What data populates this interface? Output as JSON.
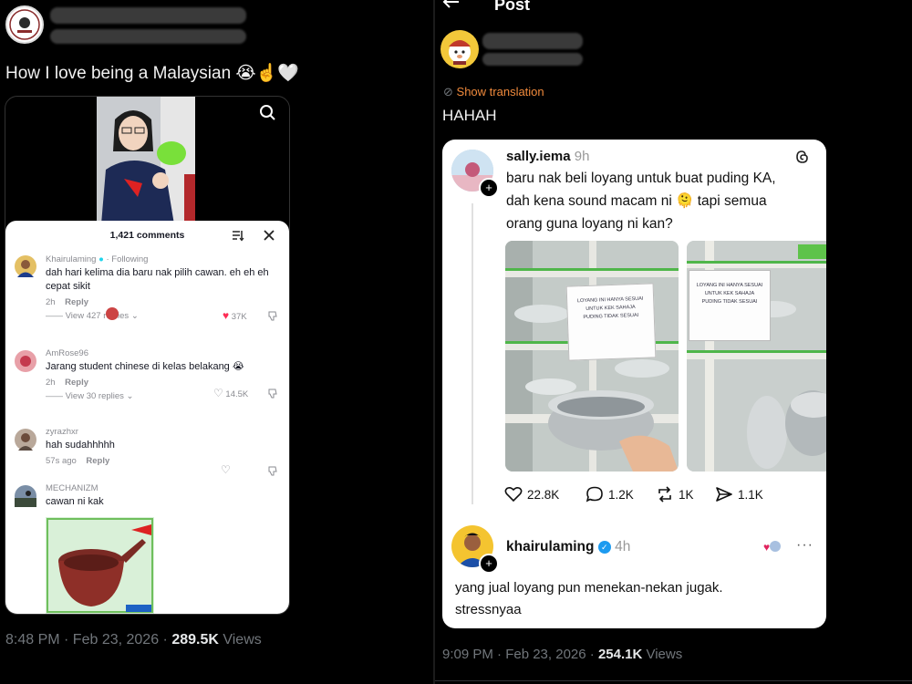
{
  "left_post": {
    "text": "How I love being a Malaysian",
    "emoji": "😭☝️🤍",
    "video": {
      "comments_count": "1,421 comments",
      "comments": [
        {
          "user": "Khairulaming",
          "badge": "Following",
          "text": "dah hari kelima dia baru nak pilih cawan. eh eh eh cepat sikit",
          "time": "2h",
          "reply": "Reply",
          "likes": "37K",
          "view_replies": "View 427 replies"
        },
        {
          "user": "AmRose96",
          "text": "Jarang student chinese di kelas belakang 😭",
          "time": "2h",
          "reply": "Reply",
          "likes": "14.5K",
          "view_replies": "View 30 replies"
        },
        {
          "user": "zyrazhxr",
          "text": "hah sudahhhhh",
          "time": "57s ago",
          "reply": "Reply"
        },
        {
          "user": "MECHANIZM",
          "text": "cawan ni kak"
        }
      ]
    },
    "timestamp": "8:48 PM · Feb 23, 2026 · ",
    "views_count": "289.5K",
    "views_label": " Views"
  },
  "right_post": {
    "header_title": "Post",
    "show_translation": "Show translation",
    "text": "HAHAH",
    "threads": {
      "user": "sally.iema",
      "age": "9h",
      "text_line1": "baru nak beli loyang untuk buat puding KA,",
      "text_line2a": "dah kena sound macam ni ",
      "text_emoji": "🫠",
      "text_line2b": " tapi semua",
      "text_line3": "orang guna loyang ni kan?",
      "sign1": [
        "LOYANG INI HANYA SESUAI",
        "UNTUK KEK SAHAJA",
        "PUDING TIDAK SESUAI"
      ],
      "sign2": [
        "LOYANG INI HANYA SESUAI",
        "UNTUK KEK SAHAJA",
        "PUDING TIDAK SESUAI"
      ],
      "likes": "22.8K",
      "comments": "1.2K",
      "reposts": "1K",
      "shares": "1.1K",
      "reply_user": "khairulaming",
      "reply_age": "4h",
      "reply_line1": "yang jual loyang pun menekan-nekan jugak.",
      "reply_line2": "stressnyaa"
    },
    "timestamp": "9:09 PM · Feb 23, 2026 · ",
    "views_count": "254.1K",
    "views_label": " Views"
  }
}
